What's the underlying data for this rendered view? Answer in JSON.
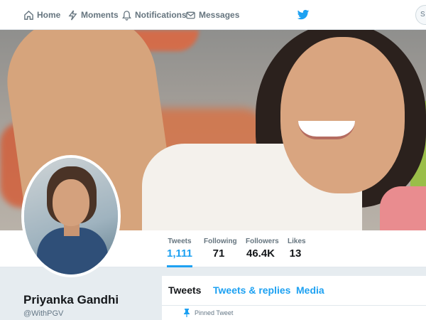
{
  "nav": {
    "home": "Home",
    "moments": "Moments",
    "notifications": "Notifications",
    "messages": "Messages",
    "search_placeholder": "S"
  },
  "colors": {
    "accent": "#1da1f2",
    "text_primary": "#14171a",
    "text_secondary": "#66757f",
    "background": "#e6ecf0"
  },
  "icons": [
    "home-icon",
    "moments-icon",
    "notifications-icon",
    "messages-icon",
    "twitter-bird-icon",
    "pin-icon"
  ],
  "stats": {
    "tweets_label": "Tweets",
    "tweets_value": "1,111",
    "following_label": "Following",
    "following_value": "71",
    "followers_label": "Followers",
    "followers_value": "46.4K",
    "likes_label": "Likes",
    "likes_value": "13"
  },
  "profile": {
    "name": "Priyanka Gandhi",
    "handle": "@WithPGV"
  },
  "tabs": {
    "tweets": "Tweets",
    "replies": "Tweets & replies",
    "media": "Media"
  },
  "pinned": {
    "label": "Pinned Tweet"
  }
}
